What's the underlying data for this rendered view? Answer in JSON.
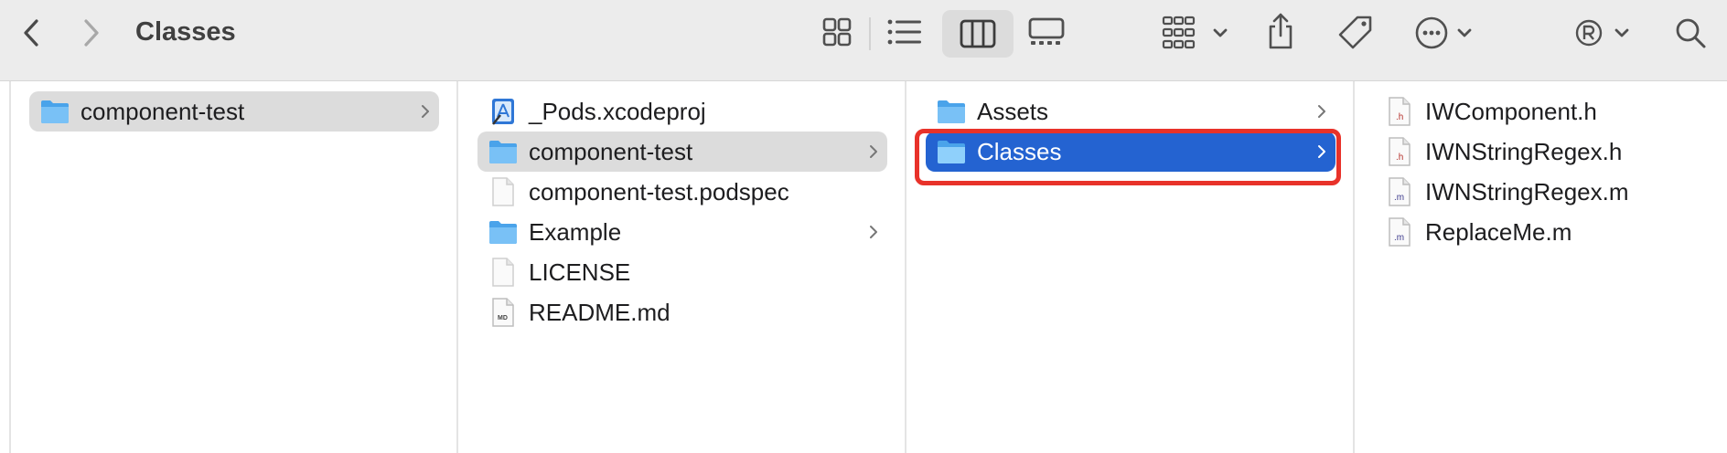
{
  "window": {
    "title": "Classes"
  },
  "toolbar": {
    "back_icon": "chevron-left-icon",
    "forward_icon": "chevron-right-icon",
    "view_modes": [
      "icon-view",
      "list-view",
      "column-view",
      "gallery-view"
    ],
    "active_view": "column-view",
    "group_icon": "group-grid-icon",
    "share_icon": "share-icon",
    "tag_icon": "tag-icon",
    "more_icon": "ellipsis-circle-icon",
    "profile_icon": "registered-icon",
    "search_icon": "search-icon"
  },
  "columns": [
    {
      "items": [
        {
          "label": "component-test",
          "type": "folder",
          "has_children": true,
          "selected": "gray"
        }
      ]
    },
    {
      "items": [
        {
          "label": "_Pods.xcodeproj",
          "type": "xcodeproj",
          "has_children": false
        },
        {
          "label": "component-test",
          "type": "folder",
          "has_children": true,
          "selected": "gray"
        },
        {
          "label": "component-test.podspec",
          "type": "file",
          "has_children": false
        },
        {
          "label": "Example",
          "type": "folder",
          "has_children": true
        },
        {
          "label": "LICENSE",
          "type": "file",
          "has_children": false
        },
        {
          "label": "README.md",
          "type": "md",
          "has_children": false,
          "badge": "MD"
        }
      ]
    },
    {
      "items": [
        {
          "label": "Assets",
          "type": "folder",
          "has_children": true
        },
        {
          "label": "Classes",
          "type": "folder",
          "has_children": true,
          "selected": "blue"
        }
      ]
    },
    {
      "items": [
        {
          "label": "IWComponent.h",
          "type": "h",
          "badge": ".h"
        },
        {
          "label": "IWNStringRegex.h",
          "type": "h",
          "badge": ".h"
        },
        {
          "label": "IWNStringRegex.m",
          "type": "m",
          "badge": ".m"
        },
        {
          "label": "ReplaceMe.m",
          "type": "m",
          "badge": ".m"
        }
      ]
    }
  ],
  "colors": {
    "selection_blue": "#2463d1",
    "selection_gray": "#dcdcdc",
    "annotation_red": "#e8322a",
    "folder_blue": "#5eb4f2"
  }
}
